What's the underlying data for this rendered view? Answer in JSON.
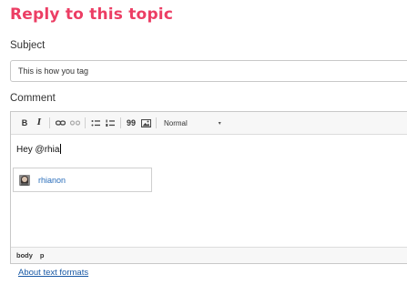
{
  "page": {
    "title": "Reply to this topic",
    "accent_color": "#ec3e64"
  },
  "subject": {
    "label": "Subject",
    "value": "This is how you tag"
  },
  "comment": {
    "label": "Comment",
    "toolbar": {
      "bold": "B",
      "italic": "I",
      "buttons": [
        "link-icon",
        "unlink-icon",
        "bulleted-list-icon",
        "numbered-list-icon",
        "blockquote-icon",
        "image-icon"
      ],
      "blockquote_glyph": "99",
      "format_value": "Normal",
      "format_caret": "▾"
    },
    "text": "Hey @rhia",
    "mention_suggestion": {
      "name": "rhianon",
      "avatar": "user-photo-avatar"
    },
    "status_path": [
      "body",
      "p"
    ]
  },
  "about_link": "About text formats"
}
